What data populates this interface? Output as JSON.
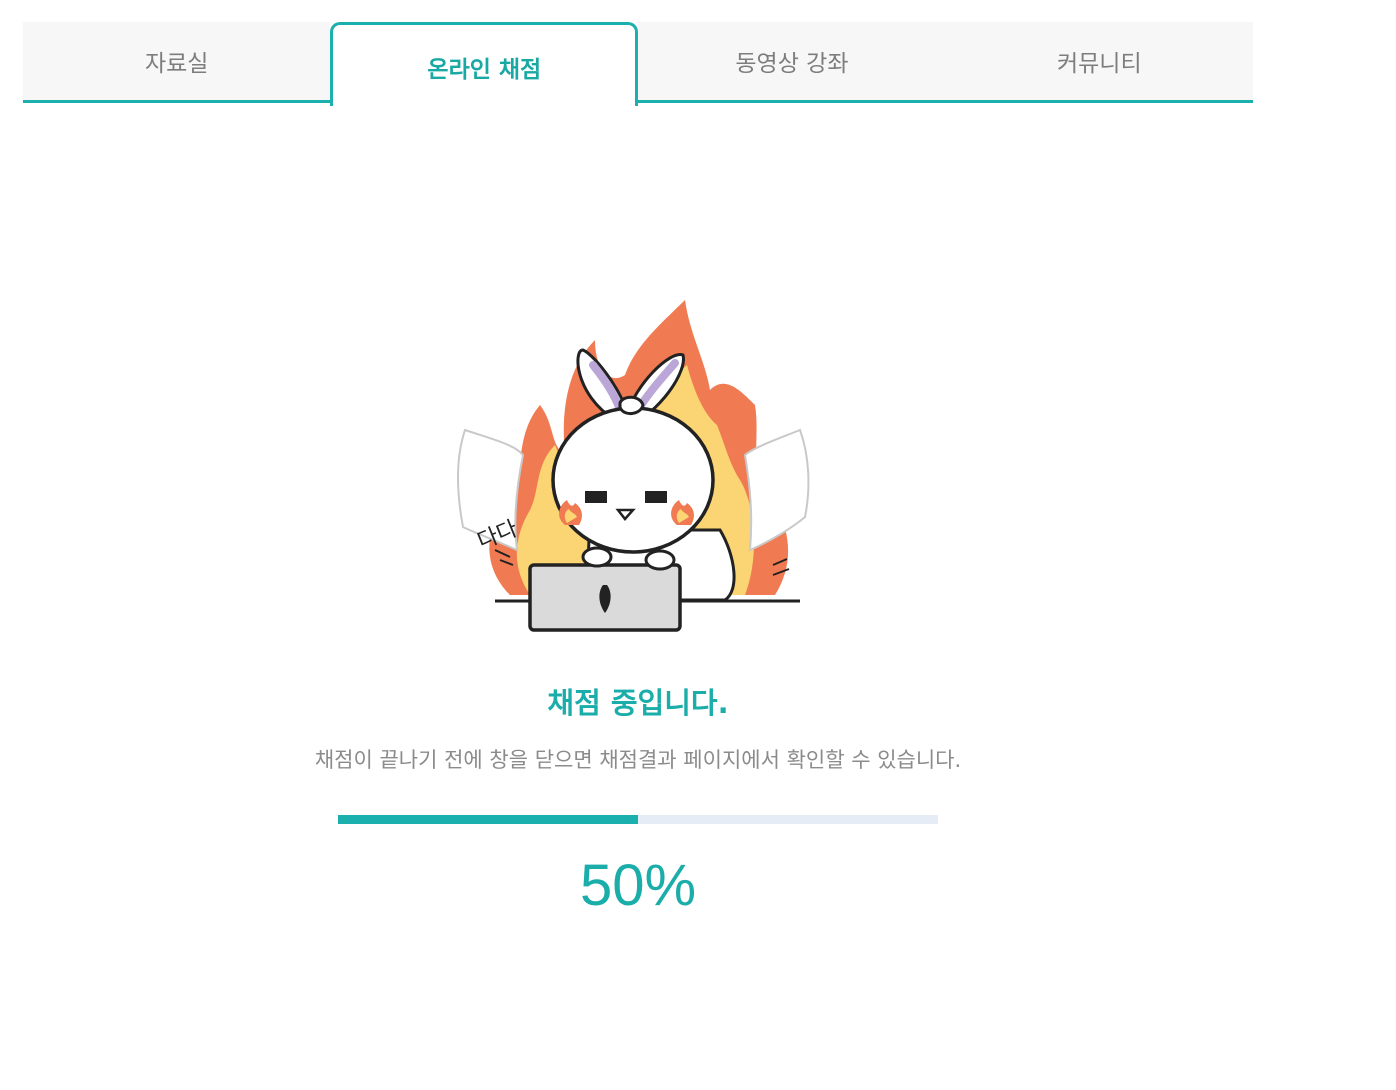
{
  "tabs": [
    {
      "label": "자료실",
      "active": false
    },
    {
      "label": "온라인 채점",
      "active": true
    },
    {
      "label": "동영상 강좌",
      "active": false
    },
    {
      "label": "커뮤니티",
      "active": false
    }
  ],
  "illustration": {
    "icon": "bunny-typing-on-laptop-with-fire",
    "sound_text": "다다"
  },
  "grading": {
    "title": "채점 중입니다.",
    "description": "채점이 끝나기 전에 창을 닫으면 채점결과 페이지에서 확인할 수 있습니다.",
    "progress_percent": 50,
    "progress_label": "50%"
  },
  "colors": {
    "accent": "#1bb0ad",
    "track": "#e5ecf6",
    "tab_bg": "#f7f7f7",
    "muted_text": "#8b8b8b"
  }
}
